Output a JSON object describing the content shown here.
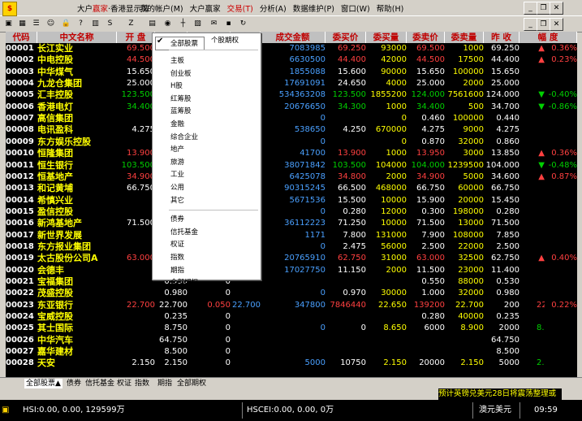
{
  "app": {
    "title_prefix": "大户",
    "title_highlight": "赢家",
    "title_suffix": "·香港显示牌",
    "colors": {
      "up": "#ff4040",
      "down": "#00d000",
      "neutral": "#ffffff",
      "name": "#ffff00",
      "header_text": "#c00000"
    }
  },
  "menu": [
    {
      "label": "我的帐户(M)",
      "highlight": false
    },
    {
      "label": "大户赢家",
      "highlight": false
    },
    {
      "label": "交易(T)",
      "highlight": true
    },
    {
      "label": "分析(A)",
      "highlight": false
    },
    {
      "label": "数据维护(P)",
      "highlight": false
    },
    {
      "label": "窗口(W)",
      "highlight": false
    },
    {
      "label": "帮助(H)",
      "highlight": false
    }
  ],
  "window_controls": {
    "minimize": "_",
    "restore": "❐",
    "close": "✕",
    "min2": "_",
    "restore2": "❐",
    "close2": "✕"
  },
  "toolbar_icons": [
    "monitor-icon",
    "grid-icon",
    "list-icon",
    "user-icon",
    "lock-icon",
    "help-icon",
    "chart-icon",
    "sh-icon",
    "sz-icon",
    "table-icon",
    "bulb-icon",
    "kline-icon",
    "multi-icon",
    "news-icon",
    "save-icon",
    "refresh-icon"
  ],
  "table": {
    "headers": [
      "代码",
      "中文名称",
      "开 盘",
      "最高",
      "最低",
      "成交量",
      "成交金额",
      "委买价",
      "委买量",
      "委卖价",
      "委卖量",
      "昨 收",
      "幅 度"
    ],
    "rows": [
      [
        "00001",
        "长江实业",
        "69.500",
        "",
        "69.500",
        "102000",
        "7083985",
        "69.250",
        "93000",
        "69.500",
        "1000",
        "69.250",
        "▲",
        "0.36%",
        "up"
      ],
      [
        "00002",
        "中电控股",
        "44.500",
        "",
        "44.500",
        "149000",
        "6630500",
        "44.400",
        "42000",
        "44.500",
        "17500",
        "44.400",
        "▲",
        "0.23%",
        "up"
      ],
      [
        "00003",
        "中华煤气",
        "15.650",
        "",
        "15.650",
        "118536",
        "1855088",
        "15.600",
        "90000",
        "15.650",
        "100000",
        "15.650",
        "",
        "",
        ""
      ],
      [
        "00004",
        "九龙仓集团",
        "25.000",
        "",
        "25.000",
        "713000",
        "17691091",
        "24.650",
        "4000",
        "25.000",
        "2000",
        "25.000",
        "",
        "",
        ""
      ],
      [
        "00005",
        "汇丰控股",
        "123.500",
        "",
        "123.500",
        "4314700",
        "534363208",
        "123.500",
        "1855200",
        "124.000",
        "7561600",
        "124.000",
        "▼",
        "-0.40%",
        "dn"
      ],
      [
        "00006",
        "香港电灯",
        "34.400",
        "",
        "34.400",
        "599000",
        "20676650",
        "34.300",
        "1000",
        "34.400",
        "500",
        "34.700",
        "▼",
        "-0.86%",
        "dn"
      ],
      [
        "00007",
        "高信集团",
        "",
        "",
        "",
        "0",
        "0",
        "",
        "0",
        "0.460",
        "100000",
        "0.440",
        "",
        "",
        ""
      ],
      [
        "00008",
        "电讯盈科",
        "4.275",
        "",
        "4.275",
        "126000",
        "538650",
        "4.250",
        "670000",
        "4.275",
        "9000",
        "4.275",
        "",
        "",
        ""
      ],
      [
        "00009",
        "东方娱乐控股",
        "",
        "",
        "",
        "0",
        "0",
        "",
        "0",
        "0.870",
        "32000",
        "0.860",
        "",
        "",
        ""
      ],
      [
        "00010",
        "恒隆集团",
        "13.900",
        "",
        "13.900",
        "3000",
        "41700",
        "13.900",
        "1000",
        "13.950",
        "3000",
        "13.850",
        "▲",
        "0.36%",
        "up"
      ],
      [
        "00011",
        "恒生银行",
        "103.500",
        "",
        "103.500",
        "367432",
        "38071842",
        "103.500",
        "104000",
        "104.000",
        "1239500",
        "104.000",
        "▼",
        "-0.48%",
        "dn"
      ],
      [
        "00012",
        "恒基地产",
        "34.900",
        "",
        "34.900",
        "185000",
        "6425078",
        "34.800",
        "2000",
        "34.900",
        "5000",
        "34.600",
        "▲",
        "0.87%",
        "up"
      ],
      [
        "00013",
        "和记黄埔",
        "66.750",
        "",
        "66.750",
        "1353427",
        "90315245",
        "66.500",
        "468000",
        "66.750",
        "60000",
        "66.750",
        "",
        "",
        ""
      ],
      [
        "00014",
        "希慎兴业",
        "",
        "",
        "",
        "366000",
        "5671536",
        "15.500",
        "10000",
        "15.900",
        "20000",
        "15.450",
        "",
        "",
        ""
      ],
      [
        "00015",
        "盈信控股",
        "",
        "",
        "",
        "0",
        "0",
        "0.280",
        "12000",
        "0.300",
        "198000",
        "0.280",
        "",
        "",
        ""
      ],
      [
        "00016",
        "新鸿基地产",
        "71.500",
        "",
        "71.500",
        "506000",
        "36112223",
        "71.250",
        "10000",
        "71.500",
        "13000",
        "71.500",
        "",
        "",
        ""
      ],
      [
        "00017",
        "新世界发展",
        "",
        "",
        "",
        "154",
        "1171",
        "7.800",
        "131000",
        "7.900",
        "108000",
        "7.850",
        "",
        "",
        ""
      ],
      [
        "00018",
        "东方报业集团",
        "",
        "",
        "",
        "0",
        "0",
        "2.475",
        "56000",
        "2.500",
        "22000",
        "2.500",
        "",
        "",
        ""
      ],
      [
        "00019",
        "太古股份公司A",
        "63.000",
        "",
        "63.000",
        "330500",
        "20765910",
        "62.750",
        "31000",
        "63.000",
        "32500",
        "62.750",
        "▲",
        "0.40%",
        "up"
      ],
      [
        "00020",
        "会德丰",
        "",
        "",
        "",
        "1499000",
        "17027750",
        "11.150",
        "2000",
        "11.500",
        "23000",
        "11.400",
        "",
        "",
        ""
      ],
      [
        "00021",
        "宝福集团",
        "",
        "0.530",
        "0",
        "",
        "",
        "",
        "",
        "0.550",
        "88000",
        "0.530",
        "",
        "",
        ""
      ],
      [
        "00022",
        "茂盛控股",
        "",
        "0.980",
        "0",
        "",
        "0",
        "0.970",
        "30000",
        "1.000",
        "32000",
        "0.980",
        "",
        "",
        ""
      ],
      [
        "00023",
        "东亚银行",
        "22.700",
        "22.700",
        "0.050",
        "22.700",
        "347800",
        "7846440",
        "22.650",
        "139200",
        "22.700",
        "200",
        "22.650",
        "0.22%",
        "up"
      ],
      [
        "00024",
        "宝威控股",
        "",
        "0.235",
        "0",
        "",
        "",
        "",
        "",
        "0.280",
        "40000",
        "0.235",
        "",
        "",
        ""
      ],
      [
        "00025",
        "其士国际",
        "",
        "8.750",
        "0",
        "",
        "0",
        "0",
        "8.650",
        "6000",
        "8.900",
        "2000",
        "8.750",
        "",
        ""
      ],
      [
        "00026",
        "中华汽车",
        "",
        "64.750",
        "0",
        "",
        "",
        "",
        "",
        "",
        "",
        "64.750",
        "",
        "",
        ""
      ],
      [
        "00027",
        "嘉华建材",
        "",
        "8.500",
        "0",
        "",
        "",
        "",
        "",
        "",
        "",
        "8.500",
        "",
        "",
        ""
      ],
      [
        "00028",
        "天安",
        "2.150",
        "2.150",
        "0",
        "",
        "5000",
        "10750",
        "2.150",
        "20000",
        "2.150",
        "5000",
        "2.150",
        "",
        ""
      ]
    ]
  },
  "dropdown": {
    "header_tab": "全部股票",
    "side_label": "个股期权",
    "items": [
      "主板",
      "创业板",
      "H股",
      "红筹股",
      "蓝筹股",
      "金融",
      "综合企业",
      "地产",
      "旅游",
      "工业",
      "公用",
      "其它",
      "债券",
      "信托基金",
      "权证",
      "指数",
      "期指",
      "全部期权"
    ]
  },
  "tabs": [
    "全部股票▲",
    "债券",
    "信托基金",
    "权证",
    "指数",
    "期指",
    "全部期权"
  ],
  "ticker": "预计英镑兑美元28日将震荡整理或",
  "status": {
    "hsi": "HSI:0.00, 0.00, 129599万",
    "hscei": "HSCEI:0.00, 0.00, 0万",
    "fx": "澳元美元",
    "time": "09:59"
  }
}
